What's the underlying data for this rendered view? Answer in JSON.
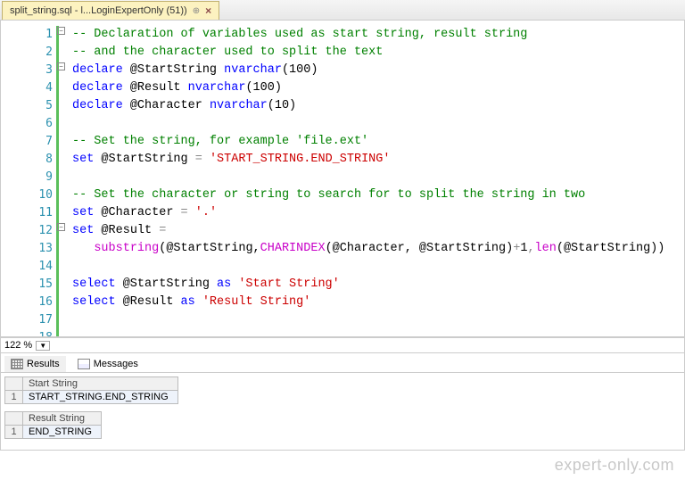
{
  "tab": {
    "title": "split_string.sql - l...LoginExpertOnly (51))"
  },
  "zoom": {
    "value": "122 %"
  },
  "gutter": {
    "lines": 18
  },
  "code": {
    "l1_comment": "-- Declaration of variables used as start string, result string",
    "l2_comment": "-- and the character used to split the text",
    "l3": {
      "kw1": "declare",
      "var": " @StartString ",
      "ty": "nvarchar",
      "args": "(100)"
    },
    "l4": {
      "kw1": "declare",
      "var": " @Result ",
      "ty": "nvarchar",
      "args": "(100)"
    },
    "l5": {
      "kw1": "declare",
      "var": " @Character ",
      "ty": "nvarchar",
      "args": "(10)"
    },
    "l7_comment": "-- Set the string, for example 'file.ext'",
    "l8": {
      "kw": "set",
      "var": " @StartString ",
      "op": "=",
      "str": " 'START_STRING.END_STRING'"
    },
    "l10_comment": "-- Set the character or string to search for to split the string in two",
    "l11": {
      "kw": "set",
      "var": " @Character ",
      "op": "=",
      "str": " '.'"
    },
    "l12": {
      "kw": "set",
      "var": " @Result ",
      "op": "="
    },
    "l13": {
      "indent": "   ",
      "fn1": "substring",
      "p1": "(@StartString,",
      "fn2": "CHARINDEX",
      "p2": "(@Character, @StartString)",
      "op1": "+",
      "n1": "1",
      "c2": ",",
      "fn3": "len",
      "p3": "(@StartString))"
    },
    "l15": {
      "kw": "select",
      "var": " @StartString ",
      "as": "as",
      "str": " 'Start String'"
    },
    "l16": {
      "kw": "select",
      "var": " @Result ",
      "as": "as",
      "str": " 'Result String'"
    }
  },
  "resTabs": {
    "results": "Results",
    "messages": "Messages"
  },
  "grids": [
    {
      "header": "Start String",
      "rownum": "1",
      "value": "START_STRING.END_STRING"
    },
    {
      "header": "Result String",
      "rownum": "1",
      "value": "END_STRING"
    }
  ],
  "watermark": "expert-only.com"
}
